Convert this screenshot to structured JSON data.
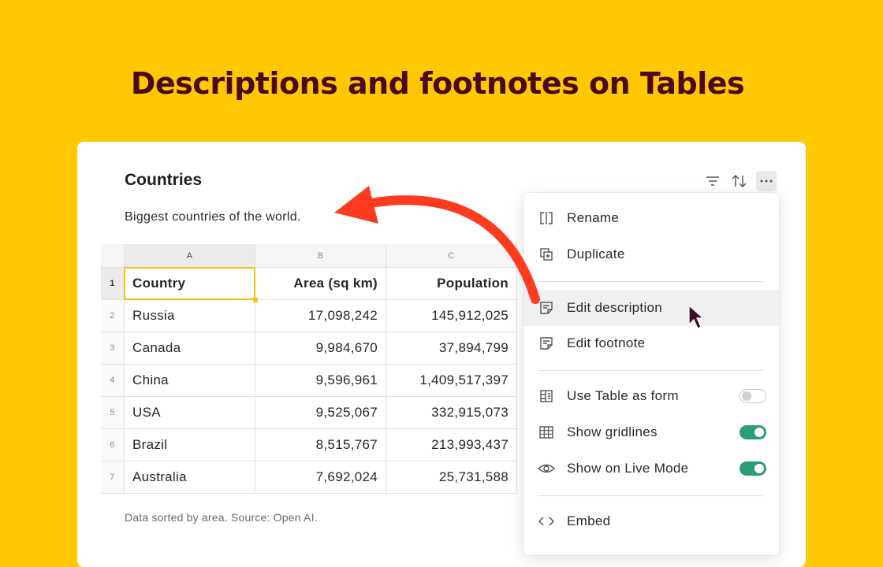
{
  "headline": "Descriptions and footnotes on Tables",
  "table": {
    "title": "Countries",
    "description": "Biggest countries of the world.",
    "footnote": "Data sorted by area. Source: Open AI.",
    "column_letters": [
      "A",
      "B",
      "C"
    ],
    "row_numbers": [
      "1",
      "2",
      "3",
      "4",
      "5",
      "6",
      "7"
    ],
    "header": [
      "Country",
      "Area (sq km)",
      "Population"
    ],
    "rows": [
      [
        "Russia",
        "17,098,242",
        "145,912,025"
      ],
      [
        "Canada",
        "9,984,670",
        "37,894,799"
      ],
      [
        "China",
        "9,596,961",
        "1,409,517,397"
      ],
      [
        "USA",
        "9,525,067",
        "332,915,073"
      ],
      [
        "Brazil",
        "8,515,767",
        "213,993,437"
      ],
      [
        "Australia",
        "7,692,024",
        "25,731,588"
      ]
    ]
  },
  "toolbar": {
    "icons": [
      "filter-icon",
      "sort-icon",
      "more-icon"
    ]
  },
  "menu": {
    "items": [
      {
        "label": "Rename",
        "icon": "rename-icon"
      },
      {
        "label": "Duplicate",
        "icon": "duplicate-icon"
      },
      {
        "label": "Edit description",
        "icon": "description-icon"
      },
      {
        "label": "Edit footnote",
        "icon": "footnote-icon"
      },
      {
        "label": "Use Table as form",
        "icon": "form-icon",
        "toggle": false
      },
      {
        "label": "Show gridlines",
        "icon": "grid-icon",
        "toggle": true
      },
      {
        "label": "Show on Live Mode",
        "icon": "eye-icon",
        "toggle": true
      },
      {
        "label": "Embed",
        "icon": "code-icon"
      }
    ]
  },
  "colors": {
    "background": "#FFC801",
    "headline": "#4a0a1c",
    "toggle_on": "#2a9d74",
    "arrow": "#FF3B1F",
    "selection": "#f1c40f"
  }
}
